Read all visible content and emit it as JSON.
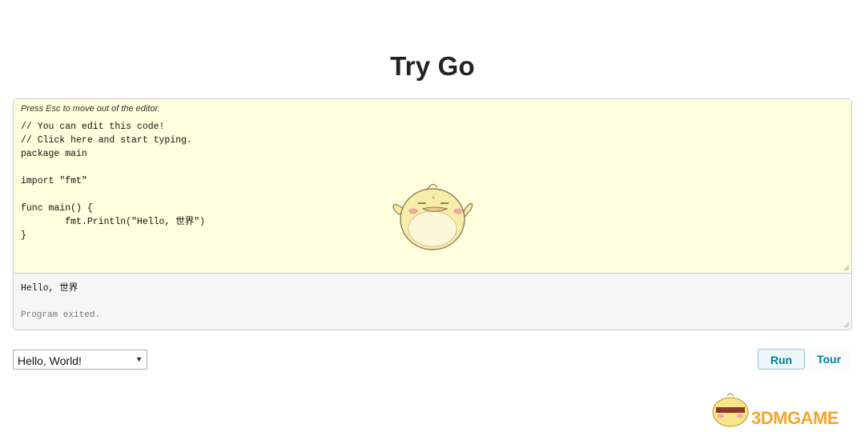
{
  "page": {
    "title": "Try Go"
  },
  "editor": {
    "hint": "Press Esc to move out of the editor.",
    "code": "// You can edit this code!\n// Click here and start typing.\npackage main\n\nimport \"fmt\"\n\nfunc main() {\n\tfmt.Println(\"Hello, 世界\")\n}",
    "background": "#ffffdd"
  },
  "output": {
    "text": "Hello, 世界",
    "status": "Program exited."
  },
  "controls": {
    "example_select": {
      "selected": "Hello, World!"
    },
    "run_label": "Run",
    "tour_label": "Tour",
    "accent": "#007d9c"
  },
  "watermark": {
    "text": "3DMGAME"
  }
}
